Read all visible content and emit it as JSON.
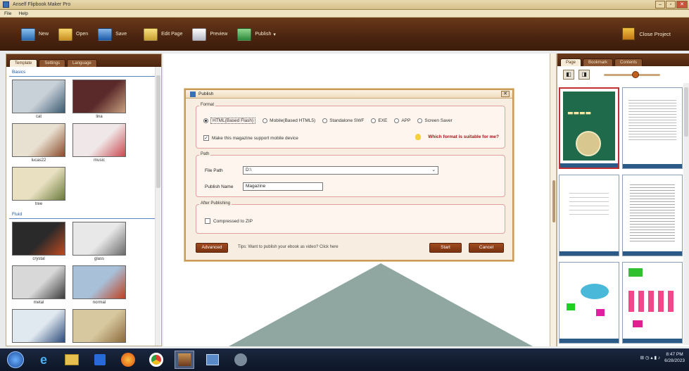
{
  "window": {
    "title": "Anself Flipbook Maker Pro",
    "min": "–",
    "max": "▫",
    "close": "✕"
  },
  "menu": [
    "File",
    "Help"
  ],
  "toolbar": {
    "items": [
      {
        "label": "New",
        "color": "#5a9ad8"
      },
      {
        "label": "Open",
        "color": "#e0b040"
      },
      {
        "label": "Save",
        "color": "#4a8ad0"
      },
      {
        "label": "Edit Page",
        "color": "#e0c050"
      },
      {
        "label": "Preview",
        "color": "#e8e8f0"
      },
      {
        "label": "Publish",
        "color": "#5ab060"
      }
    ],
    "publish_arrow": "▾",
    "close_project": "Close Project"
  },
  "left_panel": {
    "tabs": [
      "Template",
      "Settings",
      "Language"
    ],
    "section1": "Basics",
    "section1_items": [
      {
        "label": "cat",
        "c1": "#c8d0d8",
        "c2": "#3a5a70"
      },
      {
        "label": "lina",
        "c1": "#5a2a2a",
        "c2": "#c8a080"
      },
      {
        "label": "lucas22",
        "c1": "#e8e0d0",
        "c2": "#8a4a2a"
      },
      {
        "label": "music",
        "c1": "#f0e8e8",
        "c2": "#c84850"
      },
      {
        "label": "tree",
        "c1": "#e8e0c0",
        "c2": "#6a7a3a"
      }
    ],
    "section2": "Fluid",
    "section2_items": [
      {
        "label": "crystal",
        "c1": "#2a2a2a",
        "c2": "#c04a20"
      },
      {
        "label": "glass",
        "c1": "#e8e8e8",
        "c2": "#6a6a6a"
      },
      {
        "label": "metal",
        "c1": "#d8d8d8",
        "c2": "#3a3a3a"
      },
      {
        "label": "normal",
        "c1": "#a8c0d8",
        "c2": "#c04020"
      },
      {
        "label": "",
        "c1": "#e0e8f0",
        "c2": "#2a4a7a"
      },
      {
        "label": "",
        "c1": "#d8c8a0",
        "c2": "#8a6a3a"
      }
    ]
  },
  "right_panel": {
    "tabs": [
      "Page",
      "Bookmark",
      "Contents"
    ],
    "ctrl_left": "◧",
    "ctrl_right": "◨"
  },
  "dialog": {
    "title": "Publish",
    "close": "✕",
    "format_label": "Format",
    "formats": [
      "HTML(Based Flash)",
      "Mobile(Based HTML5)",
      "Standalone SWF",
      "EXE",
      "APP",
      "Screen Saver"
    ],
    "selected_format": 0,
    "mobile_support": "Make this magazine support mobile device",
    "help_link": "Which format is suitable for me?",
    "path_label": "Path",
    "file_path_label": "File Path",
    "file_path_value": "D:\\",
    "publish_name_label": "Publish Name",
    "publish_name_value": "Magazine",
    "after_label": "After Publishing",
    "compress": "Compressed to ZIP",
    "advanced": "Advanced",
    "tip": "Tips: Want to publish your ebook as video? Click here",
    "start": "Start",
    "cancel": "Cancel"
  },
  "taskbar": {
    "clock_time": "8:47 PM",
    "clock_date": "6/28/2023",
    "tray": "⊞ ◷ ▴ ▮ ♪"
  }
}
